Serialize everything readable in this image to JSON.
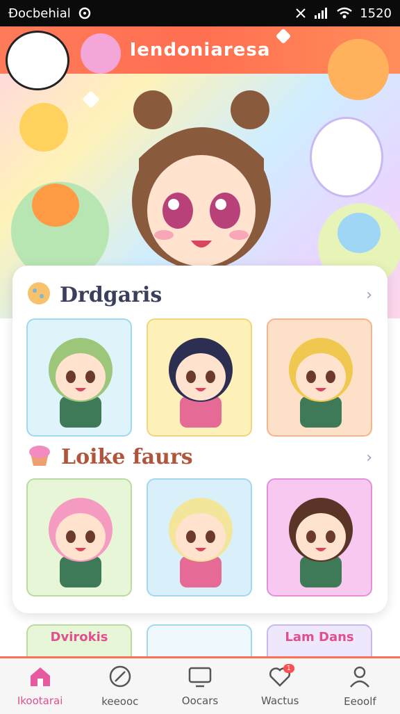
{
  "status_bar": {
    "carrier": "Ðocbehial",
    "time": "1520"
  },
  "app_bar": {
    "title": "Iendoniaresa"
  },
  "sections": [
    {
      "title": "Drdgaris",
      "tiles": [
        {
          "bg": "#dff3fb",
          "border": "#9fd8ef",
          "hair": "#9cc77b",
          "shirt": "#3f7a58"
        },
        {
          "bg": "#fdf0b8",
          "border": "#f2d47a",
          "hair": "#2d2f52",
          "shirt": "#e56a96"
        },
        {
          "bg": "#fde0c8",
          "border": "#f2b68f",
          "hair": "#f1c84f",
          "shirt": "#3f7a58"
        }
      ]
    },
    {
      "title": "Loike faurs",
      "tiles": [
        {
          "bg": "#e8f6d8",
          "border": "#b6dca0",
          "hair": "#f59ac0",
          "shirt": "#3f7a58"
        },
        {
          "bg": "#d9f0fb",
          "border": "#9fd8ef",
          "hair": "#f3e69a",
          "shirt": "#e56a96"
        },
        {
          "bg": "#f7c9f1",
          "border": "#e38fda",
          "hair": "#5a3426",
          "shirt": "#3f7a58"
        }
      ]
    }
  ],
  "bottom_cards": [
    {
      "label": "Dvirokis",
      "border": "#b6dca0",
      "bg": "#e8f6d8"
    },
    {
      "label": "",
      "border": "#9fd8ef",
      "bg": "#eef8fd"
    },
    {
      "label": "Lam Dans",
      "border": "#c9b8f1",
      "bg": "#efe8fd"
    }
  ],
  "tabs": [
    {
      "label": "Ikootarai",
      "icon": "home-icon",
      "active": true
    },
    {
      "label": "keeooc",
      "icon": "compass-icon",
      "active": false
    },
    {
      "label": "Oocars",
      "icon": "tv-icon",
      "active": false
    },
    {
      "label": "Wactus",
      "icon": "heart-icon",
      "active": false,
      "badge": "1"
    },
    {
      "label": "Eeoolf",
      "icon": "profile-icon",
      "active": false
    }
  ],
  "colors": {
    "accent": "#ff6f51",
    "active_tab": "#e04f8f",
    "title_text": "#3a3f5c"
  }
}
